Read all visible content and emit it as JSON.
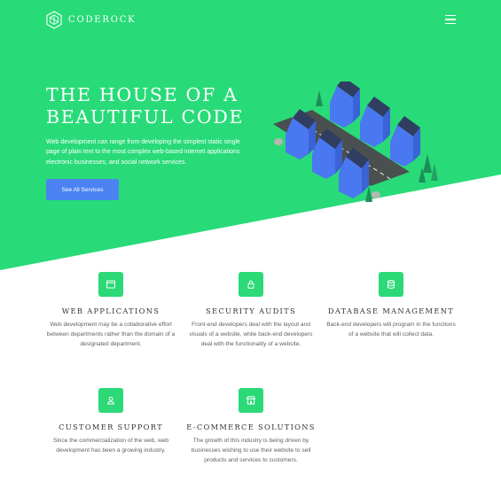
{
  "brand": {
    "name": "CODEROCK",
    "logo_icon": "hexagon-logo-icon",
    "primary_color": "#28db78",
    "accent_color": "#4b83f2"
  },
  "nav": {
    "menu_icon": "hamburger-menu-icon"
  },
  "hero": {
    "title_line1": "THE HOUSE OF A",
    "title_line2": "BEAUTIFUL CODE",
    "description": "Web development can range from developing the simplest static single page of plain text to the most complex web-based internet applications electronic businesses, and social network services.",
    "button_label": "See All Services"
  },
  "services": [
    {
      "icon": "window-icon",
      "title": "WEB APPLICATIONS",
      "text": "Web development may be a collaborative effort between departments rather than the domain of a designated department."
    },
    {
      "icon": "lock-icon",
      "title": "SECURITY AUDITS",
      "text": "Front-end developers deal with the layout and visuals of a website, while back-end developers deal with the functionality of a website."
    },
    {
      "icon": "database-icon",
      "title": "DATABASE MANAGEMENT",
      "text": "Back-end developers will program in the functions of a website that will collect data."
    },
    {
      "icon": "user-support-icon",
      "title": "CUSTOMER SUPPORT",
      "text": "Since the commercialization of the web, web development has been a growing industry."
    },
    {
      "icon": "shop-icon",
      "title": "E-COMMERCE SOLUTIONS",
      "text": "The growth of this industry is being driven by businesses wishing to use their website to sell products and services to customers."
    }
  ]
}
